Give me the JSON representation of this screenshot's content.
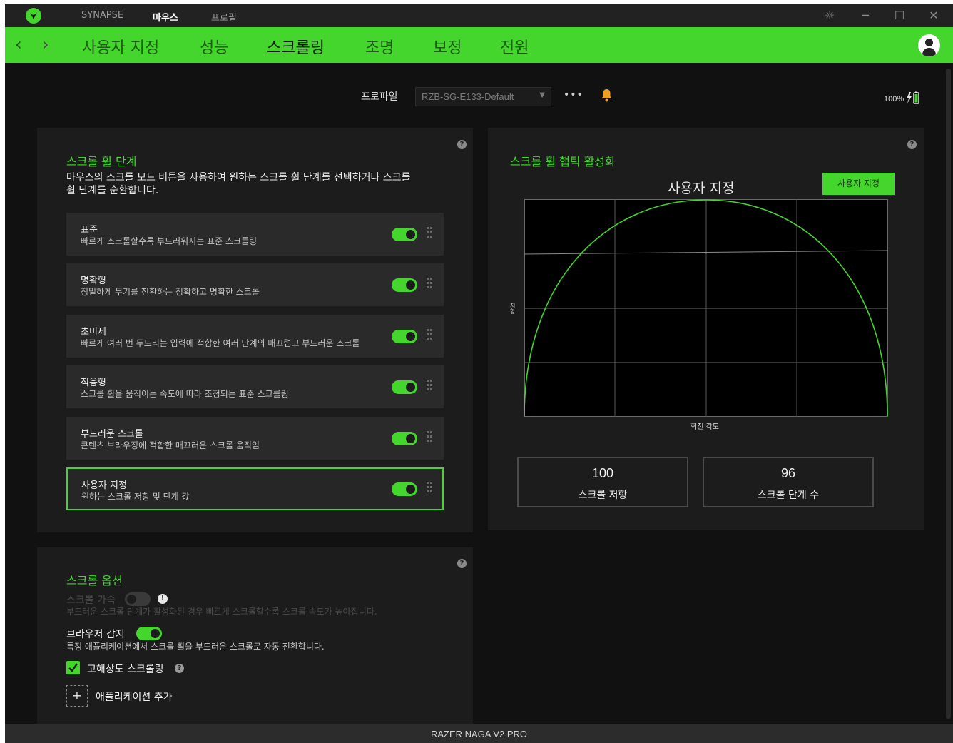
{
  "titlebar": {
    "tabs": [
      "SYNAPSE",
      "마우스",
      "프로필"
    ],
    "active_tab": "마우스"
  },
  "nav": {
    "back": "‹",
    "forward": "›",
    "tabs": [
      "사용자 지정",
      "성능",
      "스크롤링",
      "조명",
      "보정",
      "전원"
    ],
    "active_tab": "스크롤링"
  },
  "profile": {
    "label": "프로파일",
    "selected": "RZB-SG-E133-Default",
    "more": "•••",
    "battery": "100%"
  },
  "scroll_stages": {
    "title": "스크롤 휠 단계",
    "description_line1": "마우스의 스크롤 모드 버튼을 사용하여 원하는 스크롤 휠 단계를 선택하거나 스크롤",
    "description_line2": "휠 단계를 순환합니다.",
    "items": [
      {
        "name": "표준",
        "desc": "빠르게 스크롤할수록 부드러워지는 표준 스크롤링",
        "enabled": true
      },
      {
        "name": "명확형",
        "desc": "정밀하게 무기를 전환하는 정확하고 명확한 스크롤",
        "enabled": true
      },
      {
        "name": "초미세",
        "desc": "빠르게 여러 번 두드리는 입력에 적합한 여러 단계의 매끄럽고 부드러운 스크롤",
        "enabled": true
      },
      {
        "name": "적응형",
        "desc": "스크롤 휠을 움직이는 속도에 따라 조정되는 표준 스크롤링",
        "enabled": true
      },
      {
        "name": "부드러운 스크롤",
        "desc": "콘텐츠 브라우징에 적합한 매끄러운 스크롤 움직임",
        "enabled": true
      },
      {
        "name": "사용자 지정",
        "desc": "원하는 스크롤 저항 및 단계 값",
        "enabled": true,
        "selected": true
      }
    ]
  },
  "haptic": {
    "title": "스크롤 휠 햅틱 활성화",
    "chart_title": "사용자 지정",
    "custom_button": "사용자 지정",
    "ylabel": "저항",
    "xlabel": "회전 각도",
    "resistance_value": "100",
    "resistance_label": "스크롤 저항",
    "steps_value": "96",
    "steps_label": "스크롤 단계 수"
  },
  "options": {
    "title": "스크롤 옵션",
    "accel_label": "스크롤 가속",
    "accel_desc": "부드러운 스크롤 단계가 활성화된 경우 빠르게 스크롤할수록 스크롤 속도가 높아집니다.",
    "browser_label": "브라우저 감지",
    "browser_desc": "특정 애플리케이션에서 스크롤 휠을 부드러운 스크롤로 자동 전환합니다.",
    "hires_label": "고해상도 스크롤링",
    "add_app_label": "애플리케이션 추가"
  },
  "footer": {
    "device": "RAZER NAGA V2 PRO"
  },
  "colors": {
    "accent": "#44d62c",
    "background": "#111111",
    "panel": "#1c1c1c"
  }
}
